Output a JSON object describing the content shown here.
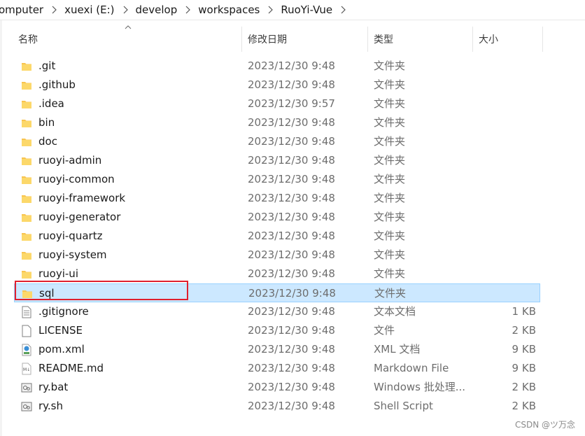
{
  "breadcrumb": [
    "omputer",
    "xuexi (E:)",
    "develop",
    "workspaces",
    "RuoYi-Vue"
  ],
  "columns": {
    "name": "名称",
    "date": "修改日期",
    "type": "类型",
    "size": "大小"
  },
  "files": [
    {
      "name": ".git",
      "date": "2023/12/30 9:48",
      "type": "文件夹",
      "size": "",
      "icon": "folder-icon"
    },
    {
      "name": ".github",
      "date": "2023/12/30 9:48",
      "type": "文件夹",
      "size": "",
      "icon": "folder-icon"
    },
    {
      "name": ".idea",
      "date": "2023/12/30 9:57",
      "type": "文件夹",
      "size": "",
      "icon": "folder-icon"
    },
    {
      "name": "bin",
      "date": "2023/12/30 9:48",
      "type": "文件夹",
      "size": "",
      "icon": "folder-icon"
    },
    {
      "name": "doc",
      "date": "2023/12/30 9:48",
      "type": "文件夹",
      "size": "",
      "icon": "folder-icon"
    },
    {
      "name": "ruoyi-admin",
      "date": "2023/12/30 9:48",
      "type": "文件夹",
      "size": "",
      "icon": "folder-icon"
    },
    {
      "name": "ruoyi-common",
      "date": "2023/12/30 9:48",
      "type": "文件夹",
      "size": "",
      "icon": "folder-icon"
    },
    {
      "name": "ruoyi-framework",
      "date": "2023/12/30 9:48",
      "type": "文件夹",
      "size": "",
      "icon": "folder-icon"
    },
    {
      "name": "ruoyi-generator",
      "date": "2023/12/30 9:48",
      "type": "文件夹",
      "size": "",
      "icon": "folder-icon"
    },
    {
      "name": "ruoyi-quartz",
      "date": "2023/12/30 9:48",
      "type": "文件夹",
      "size": "",
      "icon": "folder-icon"
    },
    {
      "name": "ruoyi-system",
      "date": "2023/12/30 9:48",
      "type": "文件夹",
      "size": "",
      "icon": "folder-icon"
    },
    {
      "name": "ruoyi-ui",
      "date": "2023/12/30 9:48",
      "type": "文件夹",
      "size": "",
      "icon": "folder-icon"
    },
    {
      "name": "sql",
      "date": "2023/12/30 9:48",
      "type": "文件夹",
      "size": "",
      "icon": "folder-icon",
      "selected": true
    },
    {
      "name": ".gitignore",
      "date": "2023/12/30 9:48",
      "type": "文本文档",
      "size": "1 KB",
      "icon": "text-document-icon"
    },
    {
      "name": "LICENSE",
      "date": "2023/12/30 9:48",
      "type": "文件",
      "size": "2 KB",
      "icon": "blank-file-icon"
    },
    {
      "name": "pom.xml",
      "date": "2023/12/30 9:48",
      "type": "XML 文档",
      "size": "9 KB",
      "icon": "xml-file-icon"
    },
    {
      "name": "README.md",
      "date": "2023/12/30 9:48",
      "type": "Markdown File",
      "size": "9 KB",
      "icon": "markdown-file-icon"
    },
    {
      "name": "ry.bat",
      "date": "2023/12/30 9:48",
      "type": "Windows 批处理...",
      "size": "2 KB",
      "icon": "script-file-icon"
    },
    {
      "name": "ry.sh",
      "date": "2023/12/30 9:48",
      "type": "Shell Script",
      "size": "2 KB",
      "icon": "script-file-icon"
    }
  ],
  "watermark": "CSDN @ツ万念",
  "colors": {
    "selection_bg": "#cce8ff",
    "selection_border": "#99d1ff",
    "highlight_box": "#e0202e",
    "folder_yellow": "#f8c44f"
  }
}
